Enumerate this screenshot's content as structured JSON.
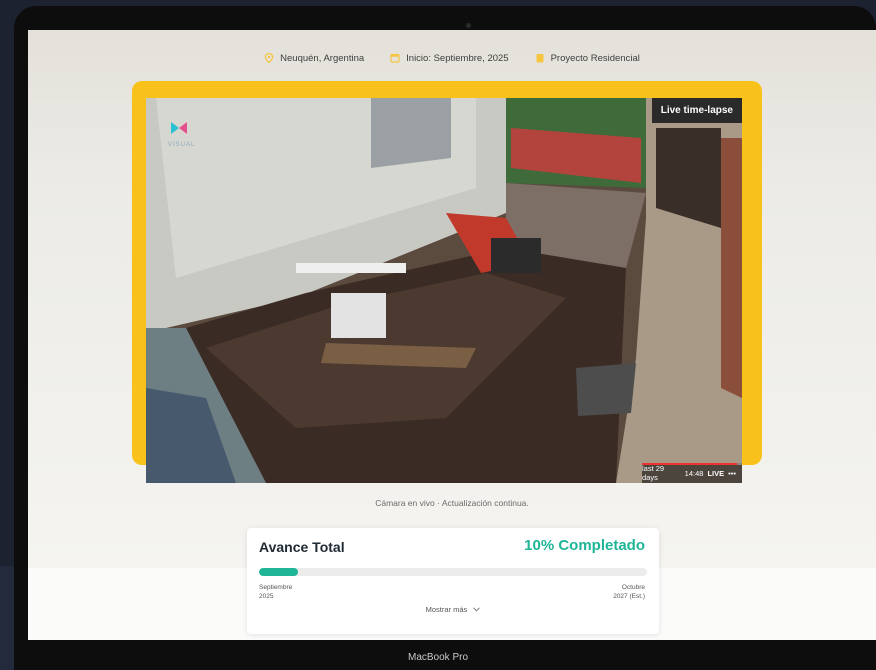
{
  "meta": {
    "location": "Neuquén, Argentina",
    "start": "Inicio: Septiembre, 2025",
    "project_type": "Proyecto Residencial"
  },
  "video": {
    "badge": "Live time-lapse",
    "logo_text": "VISUAL",
    "timeline_range": "last 29 days",
    "timeline_time": "14:48",
    "timeline_live": "LIVE",
    "timeline_more": "•••"
  },
  "caption": "Cámara en vivo · Actualización continua.",
  "progress": {
    "title": "Avance Total",
    "percent_label": "10% Completado",
    "percent": 10,
    "start_month": "Septiembre",
    "start_year": "2025",
    "end_month": "Octubre",
    "end_year": "2027 (Est.)",
    "more_label": "Mostrar más",
    "accent_color": "#1fb597"
  },
  "device": {
    "label": "MacBook Pro"
  },
  "colors": {
    "frame": "#f8c21b",
    "meta_icon": "#f5c541"
  }
}
